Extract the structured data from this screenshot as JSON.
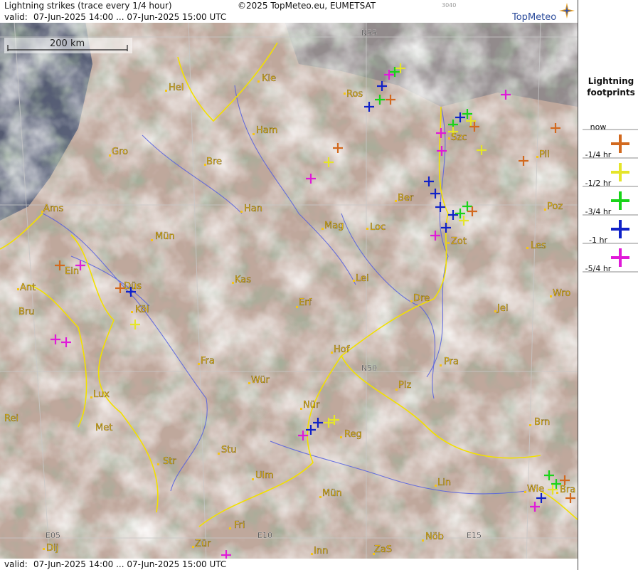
{
  "header": {
    "title": "Lightning strikes (trace every 1/4 hour)",
    "copyright": "©2025 TopMeteo.eu, EUMETSAT",
    "code": "3040",
    "valid_label": "valid:",
    "valid_range": "07-Jun-2025 14:00 ... 07-Jun-2025 15:00 UTC"
  },
  "footer": {
    "valid_label": "valid:",
    "valid_range": "07-Jun-2025 14:00 ... 07-Jun-2025 15:00 UTC"
  },
  "brand": {
    "name": "TopMeteo"
  },
  "scale_bar": {
    "label": "200 km"
  },
  "grid_labels": {
    "n55": "N55",
    "n50": "N50",
    "e05": "E05",
    "e10": "E10",
    "e15": "E15"
  },
  "legend": {
    "title_line1": "Lightning",
    "title_line2": "footprints",
    "entries": [
      {
        "label": "now",
        "color": "#d2691e"
      },
      {
        "label": "-1/4 hr",
        "color": "#e5e52a"
      },
      {
        "label": "-1/2 hr",
        "color": "#19d419"
      },
      {
        "label": "-3/4 hr",
        "color": "#1022c8"
      },
      {
        "label": "-1 hr",
        "color": "#e01ad8"
      },
      {
        "label": "-5/4 hr",
        "color": ""
      }
    ]
  },
  "cities": [
    {
      "name": "Hel"
    },
    {
      "name": "Kie"
    },
    {
      "name": "Ros"
    },
    {
      "name": "Szc"
    },
    {
      "name": "Ham"
    },
    {
      "name": "Gro"
    },
    {
      "name": "Bre"
    },
    {
      "name": "Pil"
    },
    {
      "name": "Ams"
    },
    {
      "name": "Han"
    },
    {
      "name": "Ber"
    },
    {
      "name": "Poz"
    },
    {
      "name": "Mün"
    },
    {
      "name": "Mag"
    },
    {
      "name": "Loc"
    },
    {
      "name": "Zot"
    },
    {
      "name": "Ein"
    },
    {
      "name": "Les"
    },
    {
      "name": "Ant"
    },
    {
      "name": "Düs"
    },
    {
      "name": "Kas"
    },
    {
      "name": "Lei"
    },
    {
      "name": "Bru"
    },
    {
      "name": "Köl"
    },
    {
      "name": "Erf"
    },
    {
      "name": "Dre"
    },
    {
      "name": "Jel"
    },
    {
      "name": "Wro"
    },
    {
      "name": "Hof"
    },
    {
      "name": "Fra"
    },
    {
      "name": "Pra"
    },
    {
      "name": "Wür"
    },
    {
      "name": "Plz"
    },
    {
      "name": "Lux"
    },
    {
      "name": "Rei"
    },
    {
      "name": "Nür"
    },
    {
      "name": "Met"
    },
    {
      "name": "Reg"
    },
    {
      "name": "Brn"
    },
    {
      "name": "Stu"
    },
    {
      "name": "Str"
    },
    {
      "name": "Ulm"
    },
    {
      "name": "Lin"
    },
    {
      "name": "Mün"
    },
    {
      "name": "Wie"
    },
    {
      "name": "Bra"
    },
    {
      "name": "Fri"
    },
    {
      "name": "Dij"
    },
    {
      "name": "Zür"
    },
    {
      "name": "Inn"
    },
    {
      "name": "ZaS"
    },
    {
      "name": "Nöb"
    }
  ]
}
